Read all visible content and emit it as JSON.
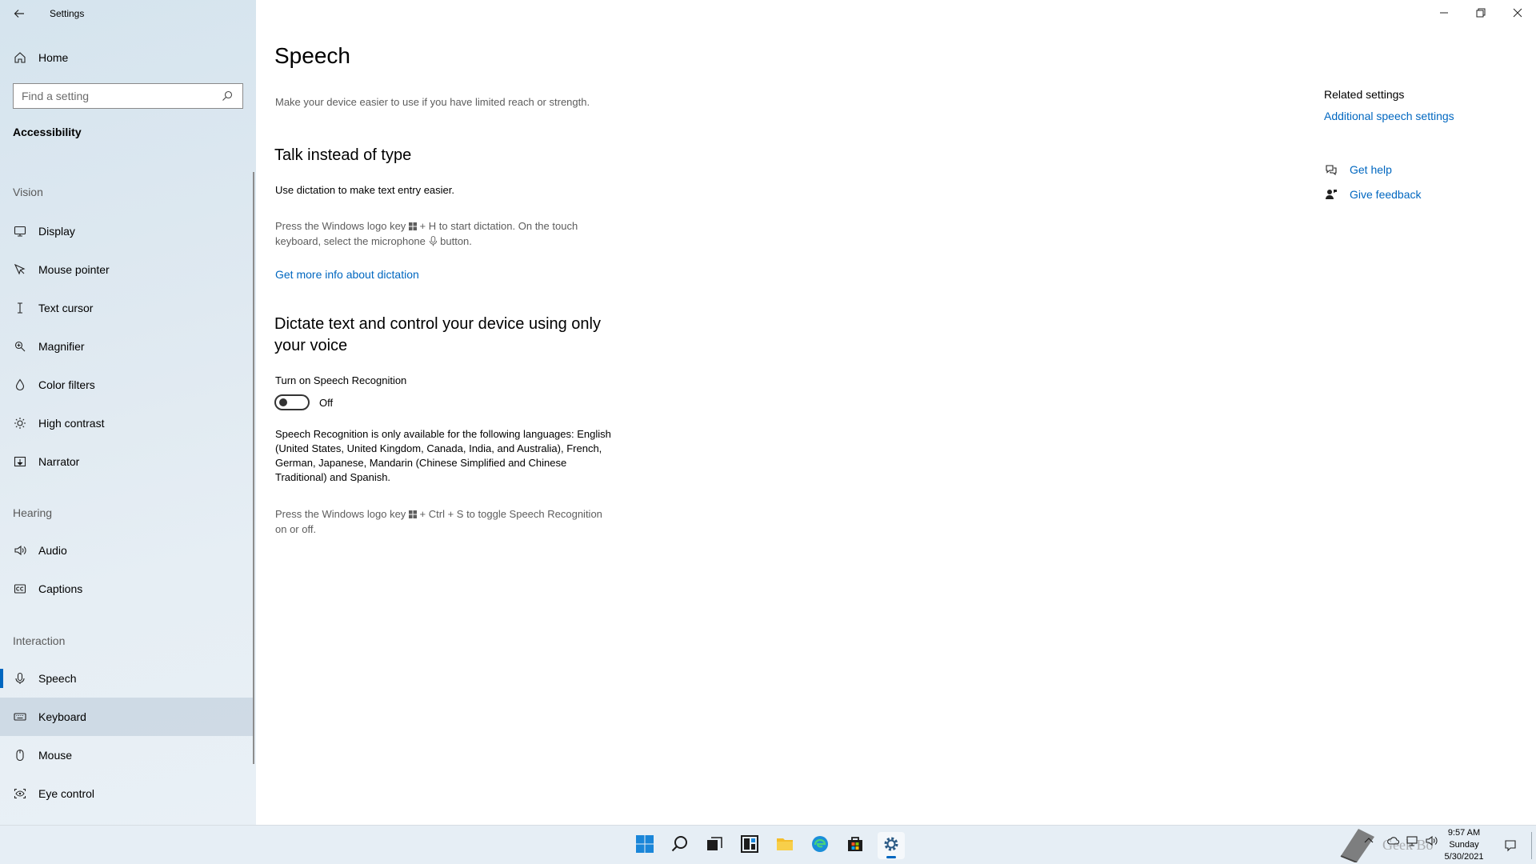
{
  "window": {
    "app_title": "Settings"
  },
  "sidebar": {
    "home_label": "Home",
    "search_placeholder": "Find a setting",
    "category": "Accessibility",
    "groups": {
      "vision": "Vision",
      "hearing": "Hearing",
      "interaction": "Interaction"
    },
    "items": {
      "display": "Display",
      "mouse_pointer": "Mouse pointer",
      "text_cursor": "Text cursor",
      "magnifier": "Magnifier",
      "color_filters": "Color filters",
      "high_contrast": "High contrast",
      "narrator": "Narrator",
      "audio": "Audio",
      "captions": "Captions",
      "speech": "Speech",
      "keyboard": "Keyboard",
      "mouse": "Mouse",
      "eye_control": "Eye control"
    },
    "selected": "speech",
    "hovered": "keyboard"
  },
  "main": {
    "title": "Speech",
    "description": "Make your device easier to use if you have limited reach or strength.",
    "section1": {
      "heading": "Talk instead of type",
      "subtitle": "Use dictation to make text entry easier.",
      "hint_part1": "Press the Windows logo key",
      "hint_part2": "+ H to start dictation.  On the touch",
      "hint_part3": "keyboard, select the microphone",
      "hint_part4": "button.",
      "link": "Get more info about dictation"
    },
    "section2": {
      "heading_line1": "Dictate text and control your device using only",
      "heading_line2": "your voice",
      "toggle_label": "Turn on Speech Recognition",
      "toggle_state": "Off",
      "languages_line1": "Speech Recognition is only available for the following languages: English",
      "languages_line2": "(United States, United Kingdom, Canada, India, and Australia), French,",
      "languages_line3": "German, Japanese, Mandarin (Chinese Simplified and Chinese",
      "languages_line4": "Traditional) and Spanish.",
      "hint_part1": "Press the Windows logo key",
      "hint_part2": "+ Ctrl + S to toggle Speech Recognition",
      "hint_part3": "on or off."
    }
  },
  "related": {
    "title": "Related settings",
    "additional_link": "Additional speech settings",
    "get_help": "Get help",
    "give_feedback": "Give feedback"
  },
  "taskbar": {
    "time": "9:57 AM",
    "day": "Sunday",
    "date": "5/30/2021",
    "watermark": "Geek Bo"
  },
  "colors": {
    "accent": "#0067c0",
    "sidebar_bg": "#dfe9f1"
  }
}
